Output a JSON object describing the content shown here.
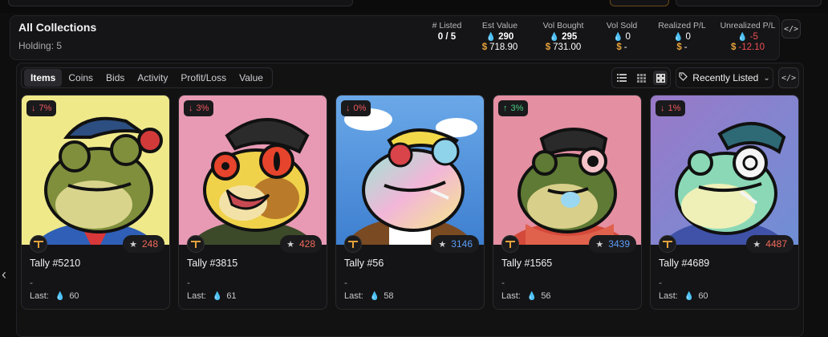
{
  "header": {
    "title": "All Collections",
    "holding": "Holding: 5",
    "stats": [
      {
        "label": "# Listed",
        "value": "0 / 5",
        "usd": ""
      },
      {
        "label": "Est Value",
        "value": "290",
        "usd": "718.90"
      },
      {
        "label": "Vol Bought",
        "value": "295",
        "usd": "731.00"
      },
      {
        "label": "Vol Sold",
        "value": "0",
        "usd": "-"
      },
      {
        "label": "Realized P/L",
        "value": "0",
        "usd": "-"
      },
      {
        "label": "Unrealized P/L",
        "value": "-5",
        "usd": "-12.10"
      }
    ]
  },
  "tabs": [
    "Items",
    "Coins",
    "Bids",
    "Activity",
    "Profit/Loss",
    "Value"
  ],
  "active_tab": "Items",
  "sort": {
    "label": "Recently Listed"
  },
  "colors": {
    "accent_blue": "#4f8ff7",
    "gold": "#e6a23c",
    "red": "#ef4f55",
    "green": "#4ccf86"
  },
  "cards": [
    {
      "name": "Tally #5210",
      "change": "7%",
      "direction": "down",
      "rank": "248",
      "rank_color": "red",
      "price": "-",
      "last_label": "Last:",
      "last": "60"
    },
    {
      "name": "Tally #3815",
      "change": "3%",
      "direction": "down",
      "rank": "428",
      "rank_color": "red",
      "price": "-",
      "last_label": "Last:",
      "last": "61"
    },
    {
      "name": "Tally #56",
      "change": "0%",
      "direction": "down",
      "rank": "3146",
      "rank_color": "blue",
      "price": "-",
      "last_label": "Last:",
      "last": "58"
    },
    {
      "name": "Tally #1565",
      "change": "3%",
      "direction": "up",
      "rank": "3439",
      "rank_color": "blue",
      "price": "-",
      "last_label": "Last:",
      "last": "56"
    },
    {
      "name": "Tally #4689",
      "change": "1%",
      "direction": "down",
      "rank": "4487",
      "rank_color": "red",
      "price": "-",
      "last_label": "Last:",
      "last": "60"
    }
  ],
  "icons": [
    "arrow-down-icon",
    "arrow-up-icon",
    "star-icon",
    "drop-icon",
    "dollar-icon",
    "code-icon",
    "list-view-icon",
    "grid-small-icon",
    "grid-large-icon",
    "tag-icon",
    "chevron-down-icon",
    "chevron-left-icon",
    "token-icon"
  ]
}
